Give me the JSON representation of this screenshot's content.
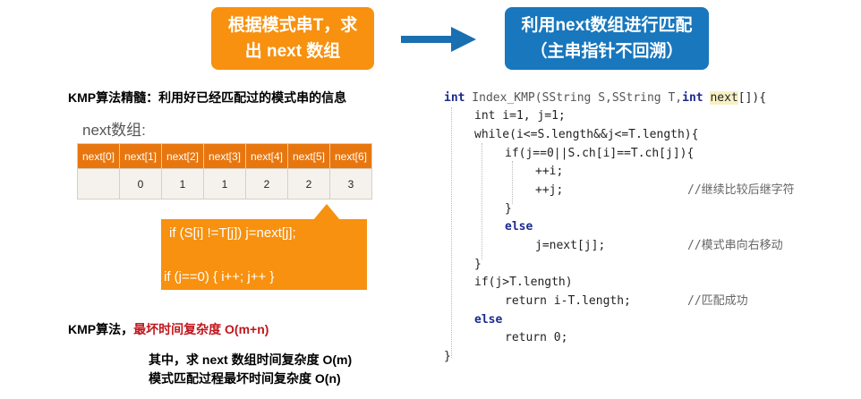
{
  "top": {
    "left_box": [
      "根据模式串T，求",
      "出 next 数组"
    ],
    "right_box": [
      "利用next数组进行匹配",
      "（主串指针不回溯）"
    ]
  },
  "essence": "KMP算法精髓：利用好已经匹配过的模式串的信息",
  "next_title": "next数组:",
  "next_table": {
    "headers": [
      "next[0]",
      "next[1]",
      "next[2]",
      "next[3]",
      "next[4]",
      "next[5]",
      "next[6]"
    ],
    "values": [
      "",
      "0",
      "1",
      "1",
      "2",
      "2",
      "3"
    ]
  },
  "callout": {
    "line1": "if (S[i] !=T[j])     j=next[j];",
    "line2": "if (j==0)    { i++; j++ }"
  },
  "complexity": {
    "prefix": "KMP算法，",
    "highlight": "最坏时间复杂度 O(m+n)",
    "detail1": "其中，求 next 数组时间复杂度 O(m)",
    "detail2": "模式匹配过程最坏时间复杂度 O(n)"
  },
  "colors": {
    "orange": "#f7910f",
    "blue": "#1877bd",
    "table_header": "#e8760f",
    "highlight_red": "#c0161c"
  },
  "code": {
    "line1_kw": "int",
    "line1_fn": " Index_KMP(SString S,SString T,",
    "line1_kw2": "int",
    "line1_next": "next",
    "line1_end": "[]){",
    "line2": "int i=1, j=1;",
    "line3": "while(i<=S.length&&j<=T.length){",
    "line4": "if(j==0||S.ch[i]==T.ch[j]){",
    "line5": "++i;",
    "line6": "++j;",
    "line6_comment": "//继续比较后继字符",
    "line7": "}",
    "line8": "else",
    "line9": "j=next[j];",
    "line9_comment": "//模式串向右移动",
    "line10": "}",
    "line11": "if(j>T.length)",
    "line12": "return i-T.length;",
    "line12_comment": "//匹配成功",
    "line13": "else",
    "line14": "return 0;",
    "line15": "}"
  }
}
